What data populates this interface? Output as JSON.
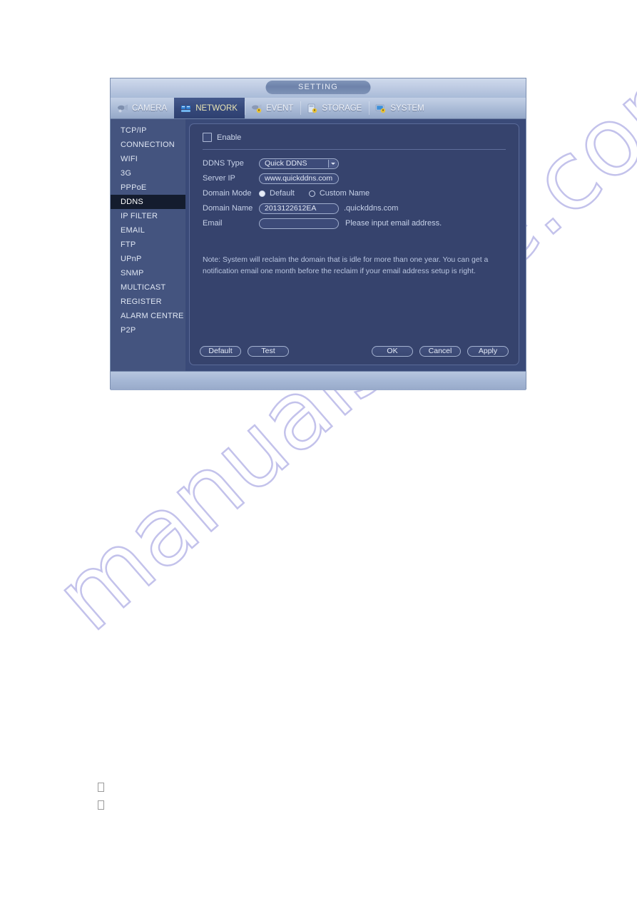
{
  "window": {
    "title": "SETTING"
  },
  "tabs": [
    {
      "label": "CAMERA",
      "icon": "camera-icon",
      "active": false
    },
    {
      "label": "NETWORK",
      "icon": "network-icon",
      "active": true
    },
    {
      "label": "EVENT",
      "icon": "event-icon",
      "active": false
    },
    {
      "label": "STORAGE",
      "icon": "storage-icon",
      "active": false
    },
    {
      "label": "SYSTEM",
      "icon": "system-icon",
      "active": false
    }
  ],
  "sidebar": {
    "items": [
      {
        "label": "TCP/IP",
        "active": false
      },
      {
        "label": "CONNECTION",
        "active": false
      },
      {
        "label": "WIFI",
        "active": false
      },
      {
        "label": "3G",
        "active": false
      },
      {
        "label": "PPPoE",
        "active": false
      },
      {
        "label": "DDNS",
        "active": true
      },
      {
        "label": "IP FILTER",
        "active": false
      },
      {
        "label": "EMAIL",
        "active": false
      },
      {
        "label": "FTP",
        "active": false
      },
      {
        "label": "UPnP",
        "active": false
      },
      {
        "label": "SNMP",
        "active": false
      },
      {
        "label": "MULTICAST",
        "active": false
      },
      {
        "label": "REGISTER",
        "active": false
      },
      {
        "label": "ALARM CENTRE",
        "active": false
      },
      {
        "label": "P2P",
        "active": false
      }
    ]
  },
  "form": {
    "enable_label": "Enable",
    "enable_checked": false,
    "ddns_type_label": "DDNS Type",
    "ddns_type_value": "Quick DDNS",
    "server_ip_label": "Server IP",
    "server_ip_value": "www.quickddns.com",
    "domain_mode_label": "Domain Mode",
    "domain_mode_default_label": "Default",
    "domain_mode_custom_label": "Custom Name",
    "domain_mode_selected": "Default",
    "domain_name_label": "Domain Name",
    "domain_name_value": "2013122612EA",
    "domain_name_suffix": ".quickddns.com",
    "email_label": "Email",
    "email_value": "",
    "email_hint": "Please input email address.",
    "note": "Note: System will reclaim the domain that is idle for more than one year. You can get a notification email one month before the reclaim if your email address setup is right."
  },
  "buttons": {
    "default": "Default",
    "test": "Test",
    "ok": "OK",
    "cancel": "Cancel",
    "apply": "Apply"
  },
  "watermark": {
    "text": "manualshive.com"
  },
  "colors": {
    "window_chrome": "#b4c4de",
    "panel_bg": "#36436d",
    "sidebar_bg": "#44547f",
    "sidebar_active_bg": "#141c2e",
    "tab_active_bg": "#35487a",
    "tab_active_text": "#e9e4b4",
    "text_primary": "#cdd7ea",
    "watermark": "#b9b8e8"
  }
}
